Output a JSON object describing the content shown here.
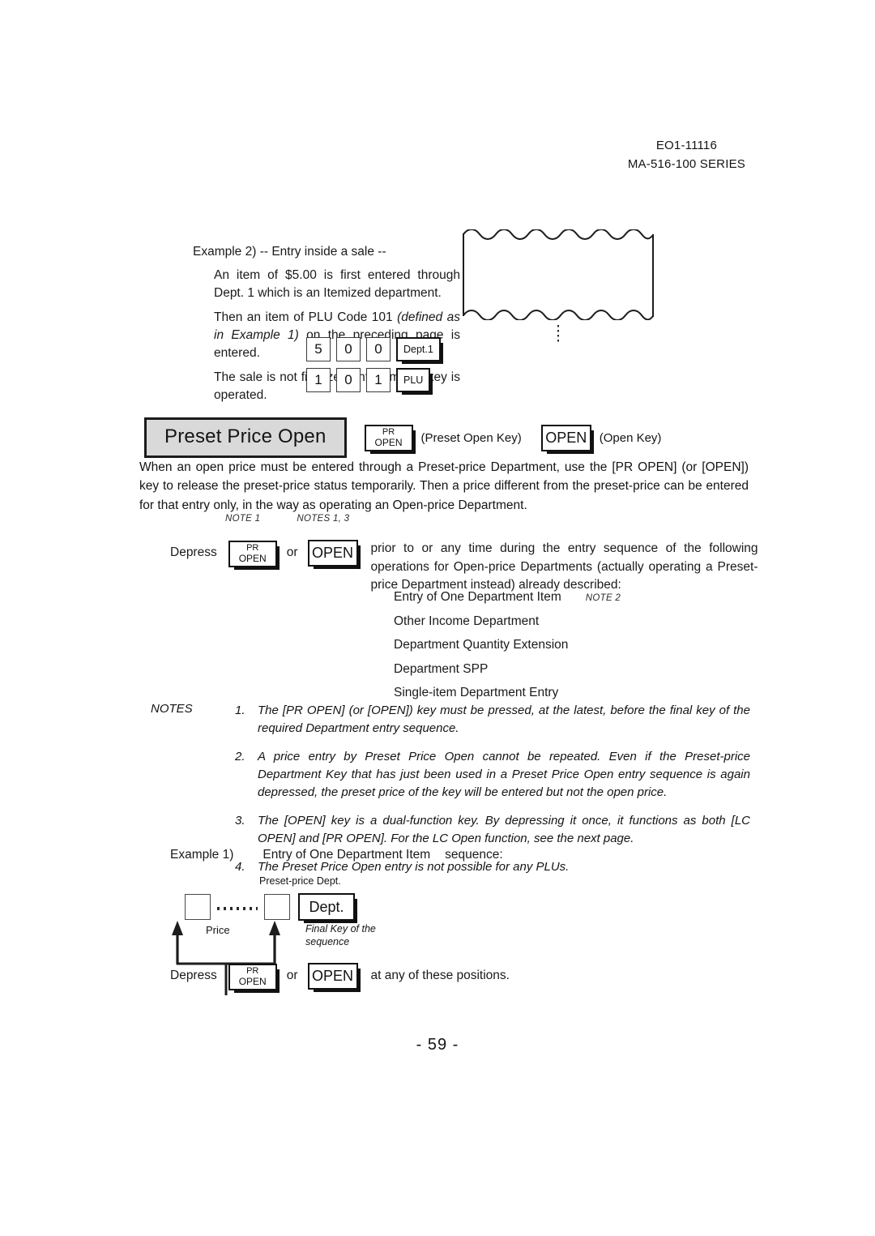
{
  "header": {
    "doc_code": "EO1-11116",
    "series": "MA-516-100 SERIES"
  },
  "example2": {
    "title": "Example 2) -- Entry inside a sale --",
    "para1": "An item of $5.00 is first entered through Dept. 1 which is an Itemized department.",
    "para2_plain_a": "Then an item of PLU Code 101 ",
    "para2_italic": "(defined as in Example 1)",
    "para2_plain_b": " on the preceding page is entered.",
    "para3": "The sale is not finalized until a media key is operated.",
    "key_sequence": [
      [
        "5",
        "0",
        "0",
        "Dept.1"
      ],
      [
        "1",
        "0",
        "1",
        "PLU"
      ]
    ]
  },
  "section": {
    "title": "Preset Price Open",
    "pr_open_key": {
      "line1": "PR",
      "line2": "OPEN"
    },
    "pr_open_caption": "(Preset Open Key)",
    "open_key": "OPEN",
    "open_caption": "(Open Key)",
    "intro": "When an open price must be entered through a Preset-price Department, use the [PR OPEN] (or [OPEN]) key to release the preset-price status temporarily. Then a price different from the preset-price can be entered for that entry only, in the way as operating an Open-price Department."
  },
  "depress_block": {
    "note_tag_left": "NOTE 1",
    "note_tag_right": "NOTES 1, 3",
    "depress_label": "Depress",
    "or_label": "or",
    "pr_open_key": {
      "line1": "PR",
      "line2": "OPEN"
    },
    "open_key": "OPEN",
    "description": "prior to or any time during the entry sequence of the following operations for Open-price Departments (actually operating a Preset-price Department instead) already described:",
    "operations": [
      {
        "label": "Entry of One Department Item",
        "note": "NOTE 2"
      },
      {
        "label": "Other Income Department",
        "note": ""
      },
      {
        "label": "Department Quantity Extension",
        "note": ""
      },
      {
        "label": "Department SPP",
        "note": ""
      },
      {
        "label": "Single-item Department Entry",
        "note": ""
      }
    ]
  },
  "notes": {
    "label": "NOTES",
    "items": [
      {
        "num": "1.",
        "text": "The [PR OPEN] (or [OPEN]) key must be pressed, at the latest, before the final key of the required Department entry sequence."
      },
      {
        "num": "2.",
        "text": "A price entry by Preset Price Open cannot be repeated. Even if the Preset-price Department Key that has just been used in a Preset Price Open entry sequence is again depressed, the preset price of the key will be entered but not the open price."
      },
      {
        "num": "3.",
        "text": "The [OPEN] key is a dual-function key. By depressing it once, it functions as both [LC OPEN] and [PR OPEN]. For the LC Open function, see the next page."
      },
      {
        "num": "4.",
        "text": "The Preset Price Open entry is not possible for any PLUs."
      }
    ]
  },
  "example1": {
    "label": "Example 1)",
    "operation": "Entry of One Department Item",
    "suffix": "sequence:",
    "diagram": {
      "preset_dept_label": "Preset-price Dept.",
      "dept_key": "Dept.",
      "price_label": "Price",
      "final_key_label_line1": "Final Key of the",
      "final_key_label_line2": "sequence"
    },
    "bottom_row": {
      "depress_label": "Depress",
      "pr_open_key": {
        "line1": "PR",
        "line2": "OPEN"
      },
      "or_label": "or",
      "open_key": "OPEN",
      "tail": "at any of these positions."
    }
  },
  "page_number": "- 59 -"
}
